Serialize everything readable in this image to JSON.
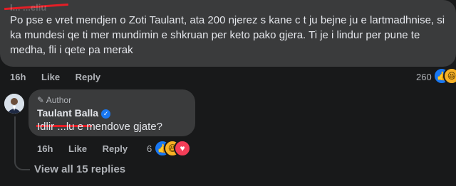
{
  "comment": {
    "author_redacted": "I... ...eliu",
    "text": "Po pse e vret mendjen o Zoti Taulant, ata 200 njerez s kane c t ju bejne ju e lartmadhnise, si ka mundesi qe ti mer mundimin e shkruan per keto pako gjera. Ti je i lindur per pune te medha, fli i qete pa merak",
    "time": "16h",
    "like_label": "Like",
    "reply_label": "Reply",
    "reaction_count": "260",
    "reactions": [
      "like-icon",
      "haha-icon"
    ]
  },
  "reply": {
    "badge": "Author",
    "author": "Taulant Balla",
    "verified": true,
    "text": "Idlir ...lu e mendove gjate?",
    "time": "16h",
    "like_label": "Like",
    "reply_label": "Reply",
    "reaction_count": "6",
    "reactions": [
      "like-icon",
      "haha-icon",
      "love-icon"
    ]
  },
  "view_replies": "View all 15 replies",
  "colors": {
    "background": "#18191a",
    "bubble": "#3a3b3c",
    "secondary_text": "#b0b3b8",
    "like_blue": "#1877f2",
    "redaction_red": "#e41e26"
  }
}
